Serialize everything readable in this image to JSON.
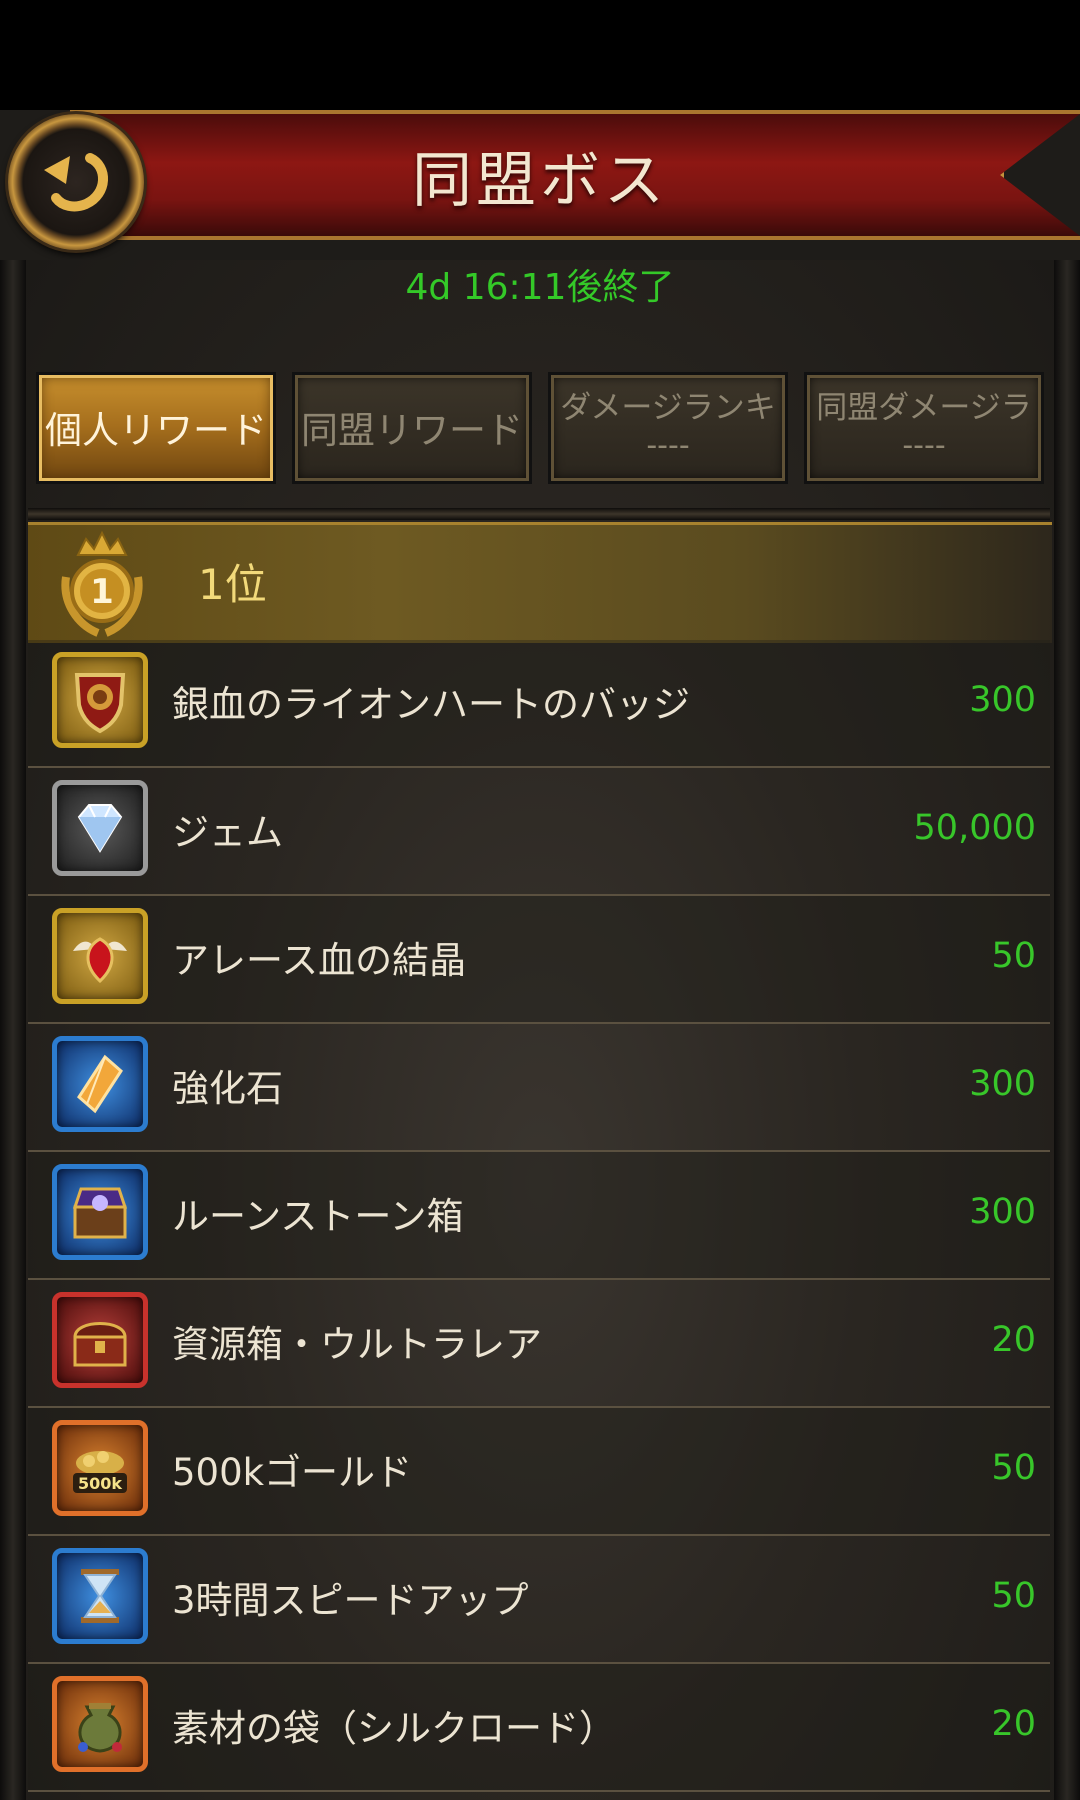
{
  "header": {
    "title": "同盟ボス"
  },
  "timer": "4d 16:11後終了",
  "tabs": [
    {
      "label": "個人リワード",
      "sub": ""
    },
    {
      "label": "同盟リワード",
      "sub": ""
    },
    {
      "label": "ダメージランキ",
      "sub": "----"
    },
    {
      "label": "同盟ダメージラ",
      "sub": "----"
    }
  ],
  "rank": {
    "medal_number": "1",
    "label": "1位"
  },
  "rewards": [
    {
      "name": "銀血のライオンハートのバッジ",
      "qty": "300",
      "icon": "lion-badge-icon"
    },
    {
      "name": "ジェム",
      "qty": "50,000",
      "icon": "gem-icon"
    },
    {
      "name": "アレース血の結晶",
      "qty": "50",
      "icon": "blood-crystal-icon"
    },
    {
      "name": "強化石",
      "qty": "300",
      "icon": "enhance-stone-icon"
    },
    {
      "name": "ルーンストーン箱",
      "qty": "300",
      "icon": "runestone-chest-icon"
    },
    {
      "name": "資源箱・ウルトラレア",
      "qty": "20",
      "icon": "resource-chest-icon"
    },
    {
      "name": "500kゴールド",
      "qty": "50",
      "icon": "gold-pile-icon",
      "badge": "500k"
    },
    {
      "name": "3時間スピードアップ",
      "qty": "50",
      "icon": "hourglass-icon"
    },
    {
      "name": "素材の袋（シルクロード）",
      "qty": "20",
      "icon": "material-bag-icon"
    }
  ]
}
